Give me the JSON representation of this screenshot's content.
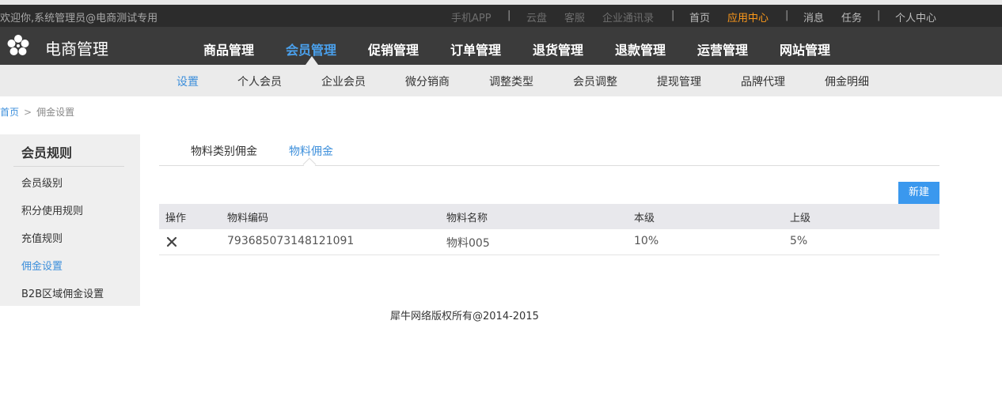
{
  "topbar": {
    "welcome": "欢迎你,系统管理员@电商测试专用",
    "links": [
      {
        "label": "手机APP",
        "style": "dim"
      },
      {
        "label": "云盘",
        "style": "dim"
      },
      {
        "label": "客服",
        "style": "dim"
      },
      {
        "label": "企业通讯录",
        "style": "dim"
      },
      {
        "label": "首页",
        "style": "normal"
      },
      {
        "label": "应用中心",
        "style": "accent"
      },
      {
        "label": "消息",
        "style": "normal"
      },
      {
        "label": "任务",
        "style": "normal"
      },
      {
        "label": "个人中心",
        "style": "normal"
      }
    ],
    "separator": "|"
  },
  "mainnav": {
    "logo_text": "电商管理",
    "items": [
      "商品管理",
      "会员管理",
      "促销管理",
      "订单管理",
      "退货管理",
      "退款管理",
      "运营管理",
      "网站管理"
    ],
    "active_index": 1
  },
  "subnav": {
    "items": [
      "设置",
      "个人会员",
      "企业会员",
      "微分销商",
      "调整类型",
      "会员调整",
      "提现管理",
      "品牌代理",
      "佣金明细"
    ],
    "active_index": 0
  },
  "breadcrumb": {
    "home": "首页",
    "separator": ">",
    "current": "佣金设置"
  },
  "sidebar": {
    "title": "会员规则",
    "items": [
      "会员级别",
      "积分使用规则",
      "充值规则",
      "佣金设置",
      "B2B区域佣金设置"
    ],
    "active_index": 3
  },
  "tabs": {
    "items": [
      "物料类别佣金",
      "物料佣金"
    ],
    "active_index": 1
  },
  "actions": {
    "new_label": "新建"
  },
  "table": {
    "columns": [
      "操作",
      "物料编码",
      "物料名称",
      "本级",
      "上级"
    ],
    "rows": [
      {
        "code": "793685073148121091",
        "name": "物料005",
        "level": "10%",
        "upper": "5%"
      }
    ]
  },
  "footer": {
    "copyright": "犀牛网络版权所有@2014-2015"
  },
  "colors": {
    "accent_blue": "#3d8fdb",
    "accent_orange": "#ff9a1a",
    "topbar_bg": "#2c2c2c",
    "nav_bg": "#3b3b3b"
  }
}
